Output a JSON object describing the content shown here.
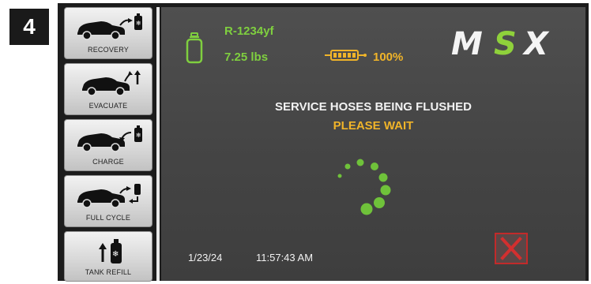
{
  "step_number": "4",
  "sidebar": {
    "items": [
      {
        "label": "RECOVERY",
        "icon": "car-recovery-icon"
      },
      {
        "label": "EVACUATE",
        "icon": "car-evacuate-icon"
      },
      {
        "label": "CHARGE",
        "icon": "car-charge-icon"
      },
      {
        "label": "FULL CYCLE",
        "icon": "car-full-cycle-icon"
      },
      {
        "label": "TANK REFILL",
        "icon": "tank-refill-icon"
      }
    ]
  },
  "header": {
    "refrigerant": "R-1234yf",
    "weight": "7.25 lbs",
    "battery_percent": "100%",
    "logo": "MSX"
  },
  "status": {
    "title": "SERVICE HOSES BEING FLUSHED",
    "subtitle": "PLEASE WAIT"
  },
  "footer": {
    "date": "1/23/24",
    "time": "11:57:43 AM"
  },
  "colors": {
    "refrigerant_green": "#7fcf3f",
    "status_orange": "#f0b429",
    "cancel_red": "#c22a2a"
  }
}
